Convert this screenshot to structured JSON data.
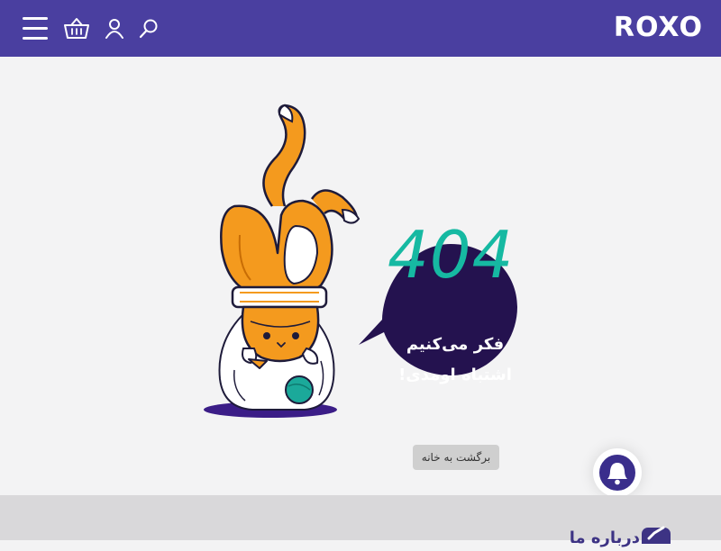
{
  "header": {
    "brand": "ROXO",
    "icons": [
      "menu-icon",
      "basket-icon",
      "user-icon",
      "search-icon"
    ]
  },
  "error_page": {
    "code": "404",
    "message_line1": "فکر می‌کنیم",
    "message_line2": "اشتباه اومدی!",
    "home_button_label": "برگشت به خانه"
  },
  "notification": {
    "icon": "bell-icon"
  },
  "footer": {
    "heading": "درباره ما",
    "icon": "check-icon"
  },
  "colors": {
    "header_bg": "#4a3fa0",
    "page_bg": "#f3f3f4",
    "accent_teal": "#16b9a2",
    "bubble": "#24124f",
    "cat_orange": "#f49a1e",
    "footer_bg": "#d9d8da"
  }
}
